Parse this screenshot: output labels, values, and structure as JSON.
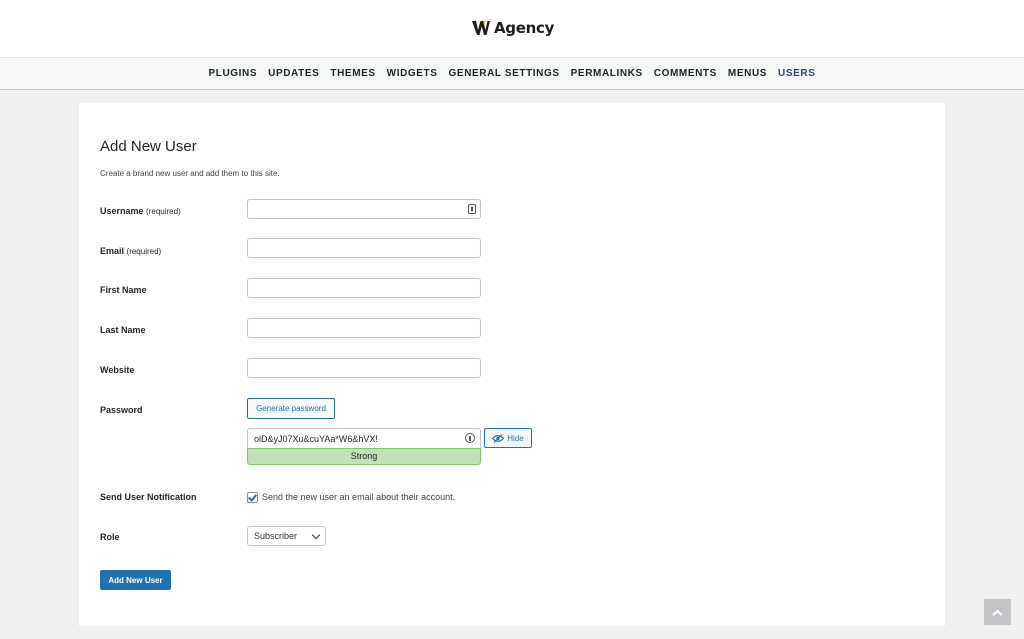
{
  "brand": {
    "logo_text": "Agency",
    "logo_icon": "w-logo-icon",
    "accent_color": "#f5a623"
  },
  "nav": {
    "items": [
      {
        "label": "PLUGINS",
        "active": false
      },
      {
        "label": "UPDATES",
        "active": false
      },
      {
        "label": "THEMES",
        "active": false
      },
      {
        "label": "WIDGETS",
        "active": false
      },
      {
        "label": "GENERAL SETTINGS",
        "active": false
      },
      {
        "label": "PERMALINKS",
        "active": false
      },
      {
        "label": "COMMENTS",
        "active": false
      },
      {
        "label": "MENUS",
        "active": false
      },
      {
        "label": "USERS",
        "active": true
      }
    ],
    "active_color": "#2c3e8f"
  },
  "form": {
    "title": "Add New User",
    "description": "Create a brand new user and add them to this site.",
    "username": {
      "label": "Username",
      "required": "(required)",
      "value": ""
    },
    "email": {
      "label": "Email",
      "required": "(required)",
      "value": ""
    },
    "first_name": {
      "label": "First Name",
      "value": ""
    },
    "last_name": {
      "label": "Last Name",
      "value": ""
    },
    "website": {
      "label": "Website",
      "value": ""
    },
    "password": {
      "label": "Password",
      "generate_label": "Generate password",
      "value": "olD&yJ07Xu&cuYAa*W6&hVX!",
      "strength": "Strong",
      "hide_label": "Hide"
    },
    "notification": {
      "label": "Send User Notification",
      "checkbox_text": "Send the new user an email about their account.",
      "checked": true
    },
    "role": {
      "label": "Role",
      "selected": "Subscriber"
    },
    "submit_label": "Add New User",
    "primary_color": "#2271b1"
  },
  "scroll_top": {
    "icon": "chevron-up-icon"
  }
}
